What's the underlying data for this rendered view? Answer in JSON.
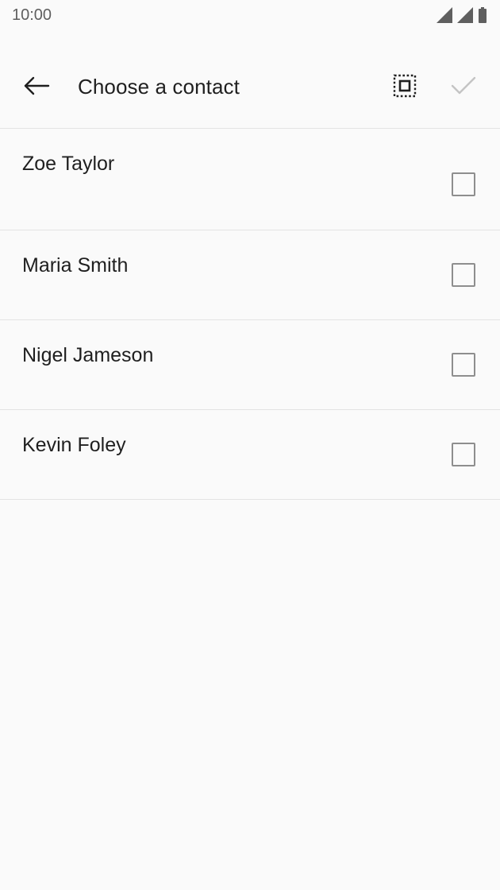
{
  "status_bar": {
    "time": "10:00",
    "icons": [
      "signal-icon",
      "signal-icon",
      "battery-icon"
    ]
  },
  "app_bar": {
    "back_icon": "arrow-back-icon",
    "title": "Choose a contact",
    "select_all_icon": "select-all-icon",
    "confirm_icon": "check-icon"
  },
  "contacts": [
    {
      "name": "Zoe Taylor",
      "checked": false
    },
    {
      "name": "Maria Smith",
      "checked": false
    },
    {
      "name": "Nigel Jameson",
      "checked": false
    },
    {
      "name": "Kevin Foley",
      "checked": false
    }
  ],
  "colors": {
    "background": "#fafafa",
    "text_primary": "#1f1f1f",
    "divider": "#e3e3e3",
    "checkbox_border": "#8e8e8e",
    "confirm_disabled": "#c4c4c4"
  }
}
